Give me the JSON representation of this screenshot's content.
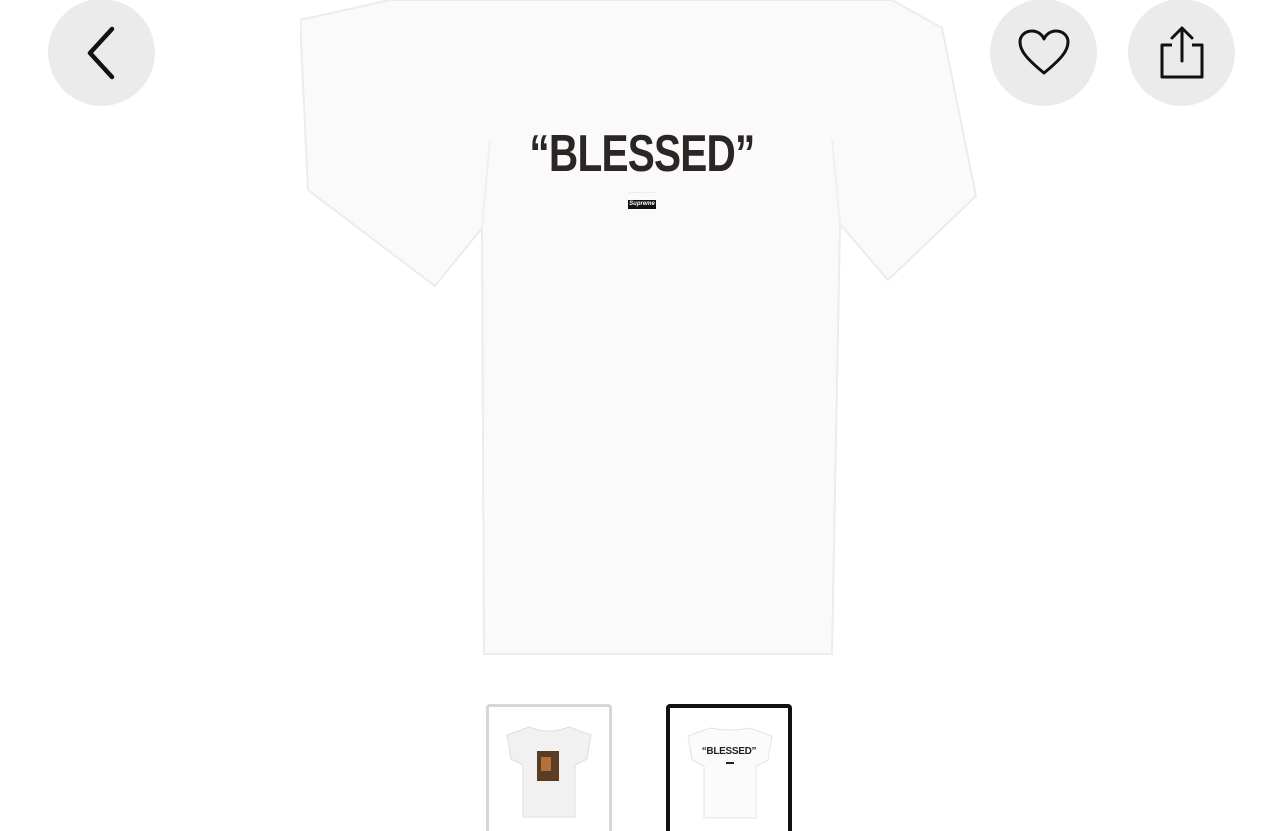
{
  "header": {
    "back_icon": "chevron-left-icon",
    "favorite_icon": "heart-outline-icon",
    "share_icon": "share-icon",
    "button_bg": "#ebebeb"
  },
  "product_image": {
    "print_text": "“BLESSED”",
    "print_logo": "Supreme"
  },
  "thumbnails": [
    {
      "selected": false,
      "border": "#d6d6d6"
    },
    {
      "selected": true,
      "border": "#111111",
      "print_text": "“BLESSED”"
    }
  ]
}
